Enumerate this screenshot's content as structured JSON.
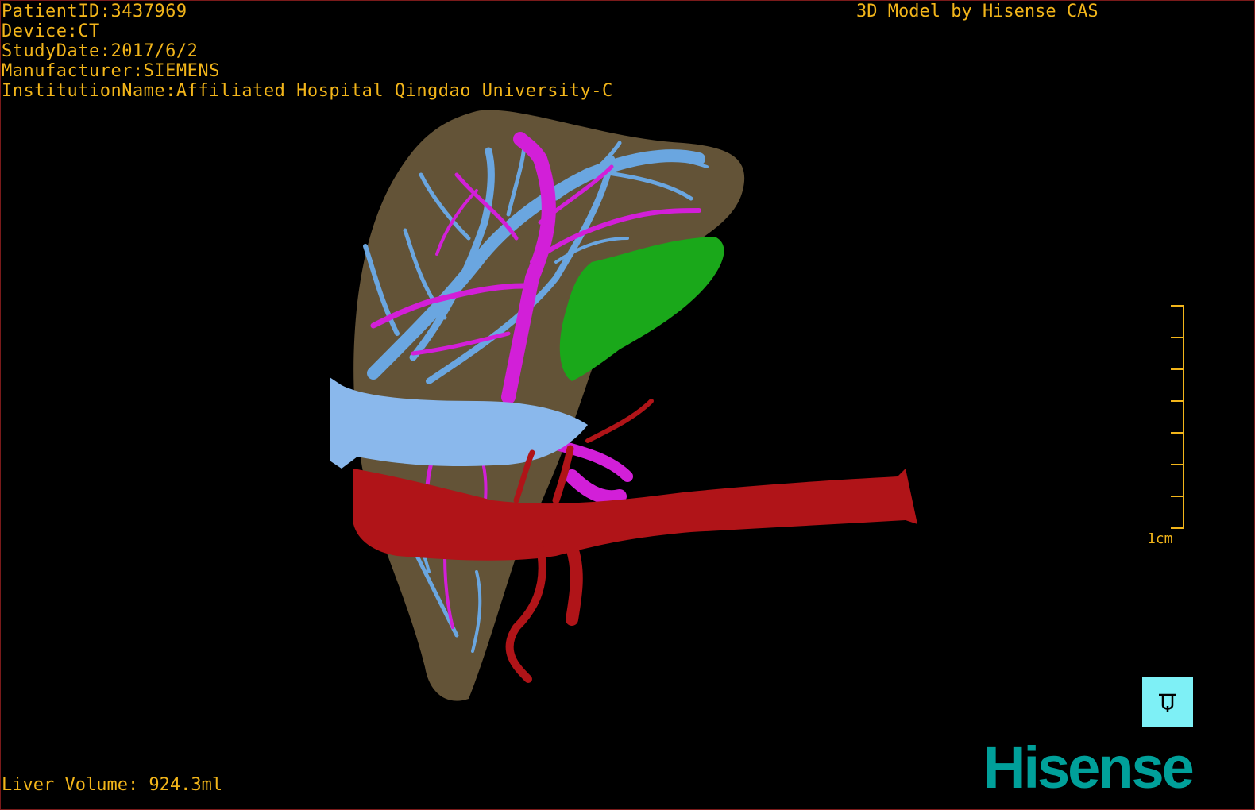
{
  "overlay": {
    "patient_id": "PatientID:3437969",
    "device": "Device:CT",
    "study_date": "StudyDate:2017/6/2",
    "manufacturer": "Manufacturer:SIEMENS",
    "institution": "InstitutionName:Affiliated Hospital Qingdao University-C",
    "credit": "3D Model by Hisense CAS",
    "liver_volume": "Liver Volume: 924.3ml"
  },
  "scale": {
    "label": "1cm"
  },
  "orientation_cube": {
    "icon": "orientation-cube-icon"
  },
  "brand": {
    "logo_text": "Hisense",
    "color": "#00a09a"
  },
  "colors": {
    "overlay_text": "#f2b51a",
    "liver": "#6b5a3c",
    "portal_vein": "#6aa6e0",
    "hepatic_artery_branches": "#d21fd8",
    "aorta": "#b01418",
    "gallbladder": "#1aa81a",
    "orientation_cube_bg": "#7ef0f6"
  }
}
